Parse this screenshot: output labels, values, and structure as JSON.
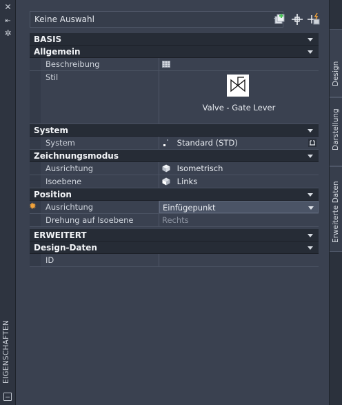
{
  "palette_title": "EIGENSCHAFTEN",
  "strip_icons": [
    "close-icon",
    "auto-hide-icon",
    "settings-icon",
    "palette-menu-icon"
  ],
  "selector": {
    "value": "Keine Auswahl"
  },
  "toolbar": {
    "icons": [
      "add-to-selection-icon",
      "select-objects-icon",
      "quick-select-icon"
    ]
  },
  "sections": {
    "basis": "BASIS",
    "allgemein": "Allgemein",
    "system": "System",
    "zeichnungsmodus": "Zeichnungsmodus",
    "position": "Position",
    "erweitert": "ERWEITERT",
    "design_daten": "Design-Daten"
  },
  "rows": {
    "beschreibung": {
      "label": "Beschreibung",
      "value": ""
    },
    "stil": {
      "label": "Stil",
      "preview_caption": "Valve - Gate Lever"
    },
    "system": {
      "label": "System",
      "value": "Standard (STD)"
    },
    "ausrichtung_zm": {
      "label": "Ausrichtung",
      "value": "Isometrisch"
    },
    "isoebene": {
      "label": "Isoebene",
      "value": "Links"
    },
    "ausrichtung_pos": {
      "label": "Ausrichtung",
      "value": "Einfügepunkt"
    },
    "drehung": {
      "label": "Drehung auf Isoebene",
      "value": "Rechts"
    },
    "id": {
      "label": "ID",
      "value": ""
    }
  },
  "tabs": [
    "Design",
    "Darstellung",
    "Erweiterte Daten"
  ],
  "colors": {
    "accent_sun": "#f2a33a",
    "green_plus": "#4cc35a",
    "background": "#3a4150"
  }
}
